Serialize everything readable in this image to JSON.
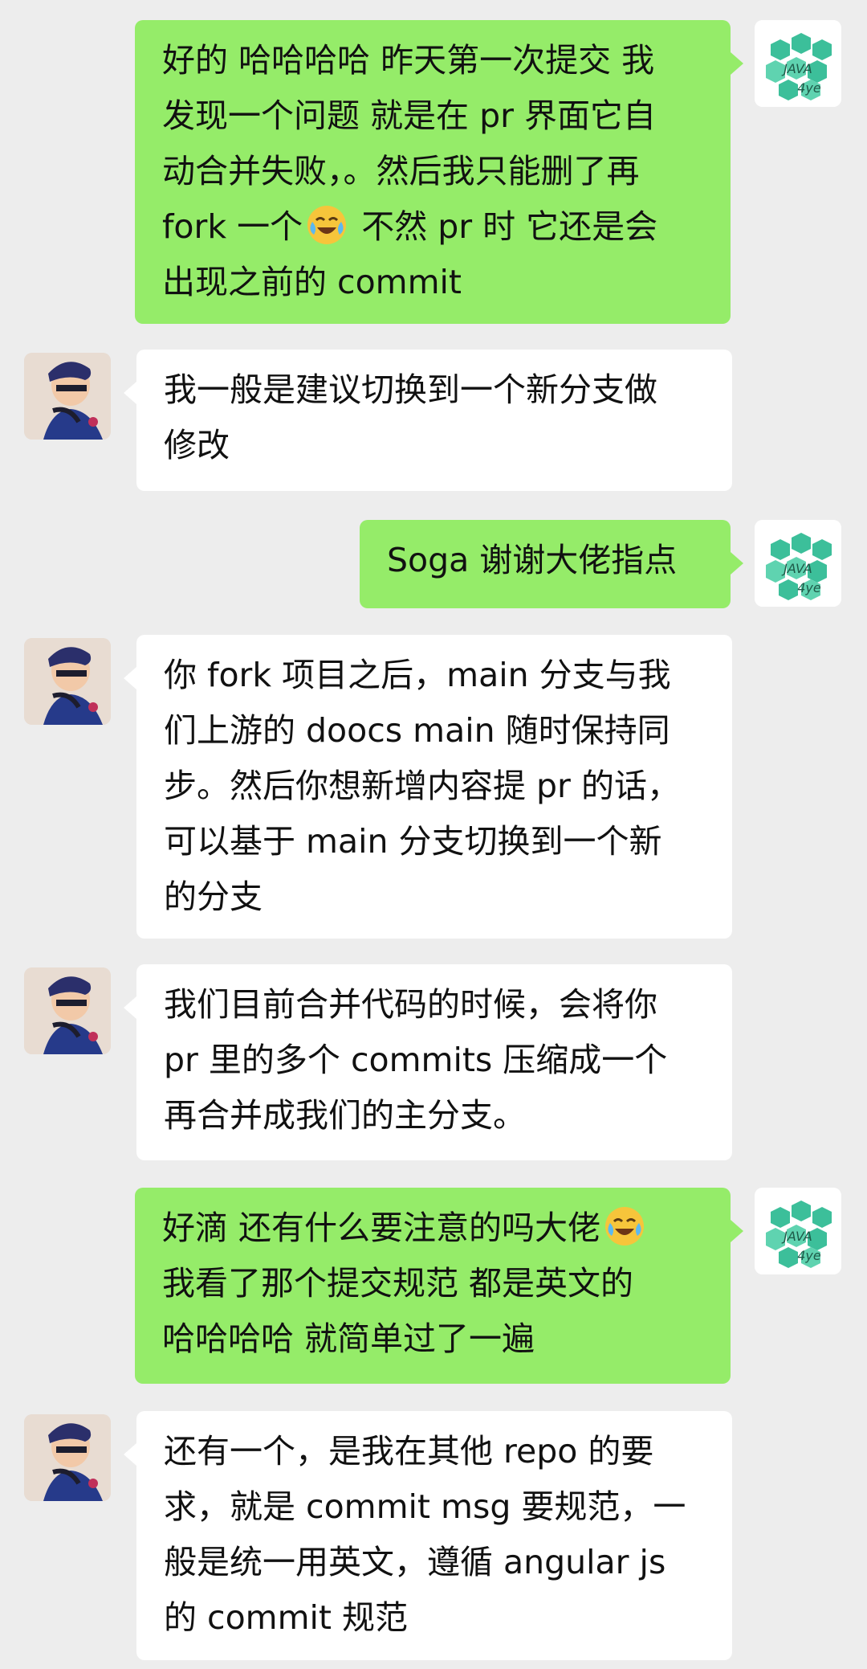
{
  "chat": {
    "messages": [
      {
        "side": "self",
        "avatar": "java4ye-logo-avatar",
        "lines": [
          "好的 哈哈哈哈 昨天第一次提交 我",
          "发现一个问题 就是在 pr 界面它自",
          "动合并失败，。然后我只能删了再",
          "fork 一个",
          "出现之前的 commit"
        ],
        "line4_suffix": " 不然 pr 时 它还是会",
        "emoji": "tears-of-joy-emoji"
      },
      {
        "side": "other",
        "avatar": "person-avatar",
        "lines": [
          "我一般是建议切换到一个新分支做",
          "修改"
        ]
      },
      {
        "side": "self",
        "avatar": "java4ye-logo-avatar",
        "lines": [
          "Soga 谢谢大佬指点"
        ]
      },
      {
        "side": "other",
        "avatar": "person-avatar",
        "lines": [
          "你 fork 项目之后，main 分支与我",
          "们上游的 doocs main 随时保持同",
          "步。然后你想新增内容提 pr 的话，",
          "可以基于 main 分支切换到一个新",
          "的分支"
        ]
      },
      {
        "side": "other",
        "avatar": "person-avatar",
        "lines": [
          "我们目前合并代码的时候，会将你",
          "pr 里的多个 commits 压缩成一个",
          "再合并成我们的主分支。"
        ]
      },
      {
        "side": "self",
        "avatar": "java4ye-logo-avatar",
        "lines": [
          "好滴 还有什么要注意的吗大佬",
          "我看了那个提交规范 都是英文的",
          "哈哈哈哈 就简单过了一遍"
        ],
        "emoji": "tears-of-joy-emoji"
      },
      {
        "side": "other",
        "avatar": "person-avatar",
        "lines": [
          "还有一个，是我在其他 repo 的要",
          "求，就是 commit msg 要规范，一",
          "般是统一用英文，遵循 angular js",
          "的 commit 规范"
        ]
      }
    ]
  },
  "avatar_logo_text": {
    "line1": "JAVA",
    "line2": "4ye"
  },
  "colors": {
    "background": "#ededed",
    "self_bubble": "#95ec69",
    "other_bubble": "#ffffff",
    "logo_green": "#3cbf9a"
  }
}
